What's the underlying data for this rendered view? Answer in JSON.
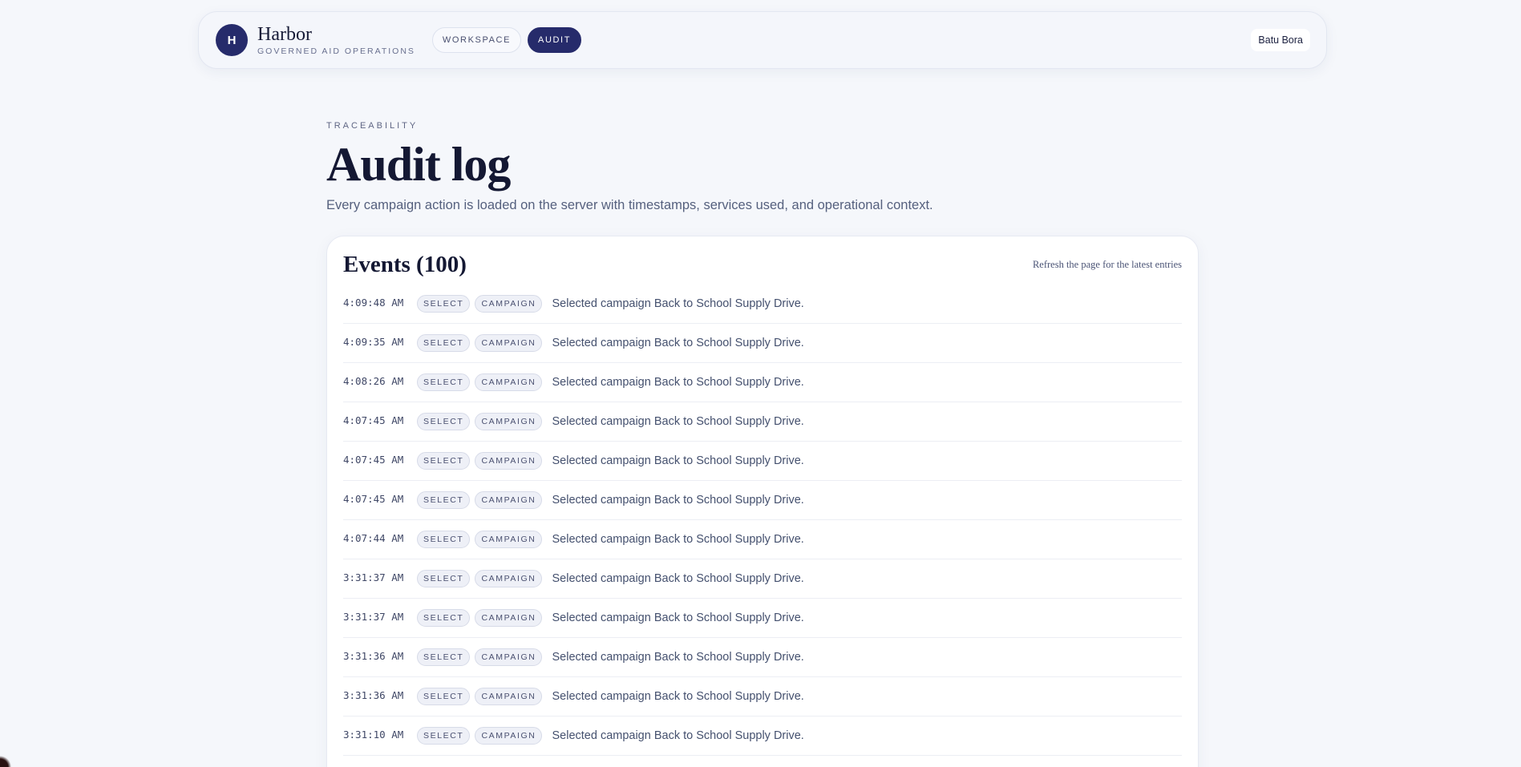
{
  "header": {
    "logo_letter": "H",
    "brand_name": "Harbor",
    "brand_tagline": "GOVERNED AID OPERATIONS",
    "nav": [
      {
        "label": "WORKSPACE",
        "active": false
      },
      {
        "label": "AUDIT",
        "active": true
      }
    ],
    "user_name": "Batu Bora"
  },
  "page": {
    "eyebrow": "TRACEABILITY",
    "title": "Audit log",
    "subtitle": "Every campaign action is loaded on the server with timestamps, services used, and operational context."
  },
  "events_panel": {
    "title": "Events (100)",
    "hint": "Refresh the page for the latest entries",
    "events": [
      {
        "time": "4:09:48 AM",
        "action": "SELECT",
        "entity": "CAMPAIGN",
        "description": "Selected campaign Back to School Supply Drive."
      },
      {
        "time": "4:09:35 AM",
        "action": "SELECT",
        "entity": "CAMPAIGN",
        "description": "Selected campaign Back to School Supply Drive."
      },
      {
        "time": "4:08:26 AM",
        "action": "SELECT",
        "entity": "CAMPAIGN",
        "description": "Selected campaign Back to School Supply Drive."
      },
      {
        "time": "4:07:45 AM",
        "action": "SELECT",
        "entity": "CAMPAIGN",
        "description": "Selected campaign Back to School Supply Drive."
      },
      {
        "time": "4:07:45 AM",
        "action": "SELECT",
        "entity": "CAMPAIGN",
        "description": "Selected campaign Back to School Supply Drive."
      },
      {
        "time": "4:07:45 AM",
        "action": "SELECT",
        "entity": "CAMPAIGN",
        "description": "Selected campaign Back to School Supply Drive."
      },
      {
        "time": "4:07:44 AM",
        "action": "SELECT",
        "entity": "CAMPAIGN",
        "description": "Selected campaign Back to School Supply Drive."
      },
      {
        "time": "3:31:37 AM",
        "action": "SELECT",
        "entity": "CAMPAIGN",
        "description": "Selected campaign Back to School Supply Drive."
      },
      {
        "time": "3:31:37 AM",
        "action": "SELECT",
        "entity": "CAMPAIGN",
        "description": "Selected campaign Back to School Supply Drive."
      },
      {
        "time": "3:31:36 AM",
        "action": "SELECT",
        "entity": "CAMPAIGN",
        "description": "Selected campaign Back to School Supply Drive."
      },
      {
        "time": "3:31:36 AM",
        "action": "SELECT",
        "entity": "CAMPAIGN",
        "description": "Selected campaign Back to School Supply Drive."
      },
      {
        "time": "3:31:10 AM",
        "action": "SELECT",
        "entity": "CAMPAIGN",
        "description": "Selected campaign Back to School Supply Drive."
      }
    ]
  }
}
